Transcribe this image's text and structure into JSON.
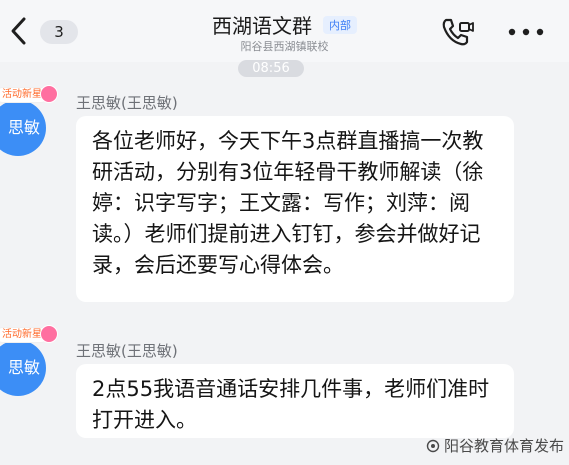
{
  "header": {
    "unread_count": "3",
    "title": "西湖语文群",
    "badge": "内部",
    "subtitle": "阳谷县西湖镇联校"
  },
  "chat": {
    "timestamp": "08:56",
    "messages": [
      {
        "avatar_text": "思敏",
        "avatar_badge": "活动新星",
        "sender": "王思敏(王思敏)",
        "text": "各位老师好，今天下午3点群直播搞一次教研活动，分别有3位年轻骨干教师解读（徐婷：识字写字；王文露：写作；刘萍：阅读。）老师们提前进入钉钉，参会并做好记录，会后还要写心得体会。"
      },
      {
        "avatar_text": "思敏",
        "avatar_badge": "活动新星",
        "sender": "王思敏(王思敏)",
        "text": "2点55我语音通话安排几件事，老师们准时打开进入。"
      }
    ]
  },
  "watermark": "阳谷教育体育发布",
  "colors": {
    "accent_blue": "#3c8ef6",
    "bubble": "#ffffff",
    "background": "#f2f3f5"
  },
  "icons": [
    "back-chevron-icon",
    "video-call-icon",
    "more-dots-icon",
    "wechat-channel-icon"
  ]
}
